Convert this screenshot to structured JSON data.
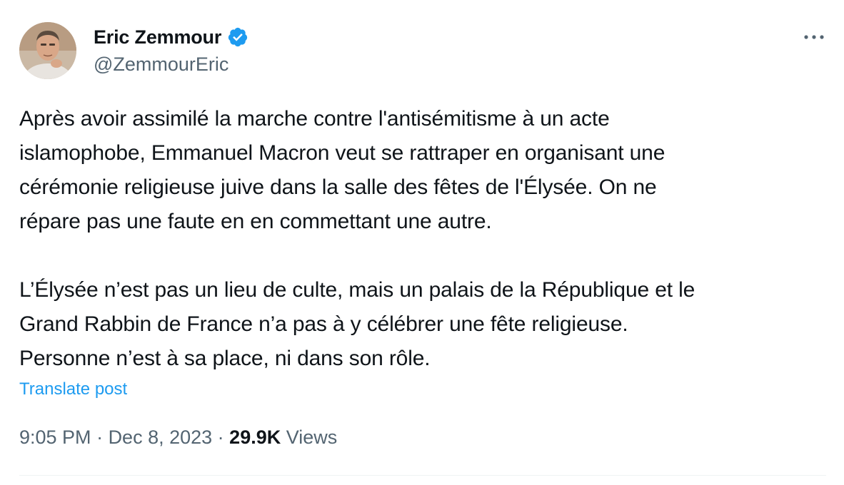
{
  "author": {
    "display_name": "Eric Zemmour",
    "handle": "@ZemmourEric",
    "verified_icon": "verified-badge-icon"
  },
  "more_icon": "more-options-icon",
  "tweet": {
    "paragraphs": [
      "Après avoir assimilé la marche contre l'antisémitisme à un acte\nislamophobe, Emmanuel Macron veut se rattraper en organisant une\ncérémonie religieuse juive dans la salle des fêtes de l'Élysée. On ne\nrépare pas une faute en en commettant une autre.",
      "L’Élysée n’est pas un lieu de culte, mais un palais de la République et le\nGrand Rabbin de France n’a pas à y célébrer une fête religieuse.\nPersonne n’est à sa place, ni dans son rôle."
    ],
    "translate_label": "Translate post"
  },
  "meta": {
    "time": "9:05 PM",
    "separator": " · ",
    "date": "Dec 8, 2023",
    "views_count": "29.9K",
    "views_label": " Views"
  },
  "colors": {
    "text": "#0f1419",
    "secondary": "#536471",
    "link": "#1d9bf0",
    "verified": "#1d9bf0"
  }
}
